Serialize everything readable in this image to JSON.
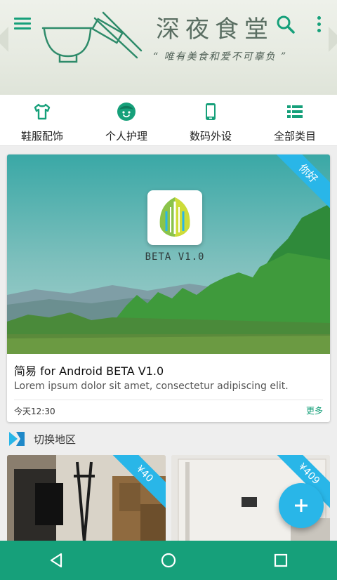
{
  "header": {
    "brand_title": "深夜食堂",
    "slogan": "“ 唯有美食和爱不可辜负 ”",
    "menu_icon": "menu-icon",
    "search_icon": "search-icon",
    "more_icon": "more-vert-icon",
    "accent_color": "#16a07a"
  },
  "categories": [
    {
      "label": "鞋服配饰",
      "icon": "tshirt-icon"
    },
    {
      "label": "个人护理",
      "icon": "face-icon"
    },
    {
      "label": "数码外设",
      "icon": "smartphone-icon"
    },
    {
      "label": "全部类目",
      "icon": "list-icon"
    }
  ],
  "card": {
    "ribbon": "你好",
    "app_label": "BETA V1.0",
    "title": "简易 for Android BETA V1.0",
    "description": "Lorem ipsum dolor sit amet, consectetur adipiscing elit.",
    "time": "今天12:30",
    "more": "更多"
  },
  "section": {
    "label": "切换地区",
    "icon": "switch-region-icon"
  },
  "products": [
    {
      "price": "¥40"
    },
    {
      "price": "¥409"
    }
  ],
  "fab": {
    "icon": "add-icon"
  },
  "navbar": {
    "back_icon": "back-triangle-icon",
    "home_icon": "home-circle-icon",
    "recents_icon": "recents-square-icon"
  },
  "colors": {
    "primary": "#16a07a",
    "ribbon": "#29b6e8"
  }
}
